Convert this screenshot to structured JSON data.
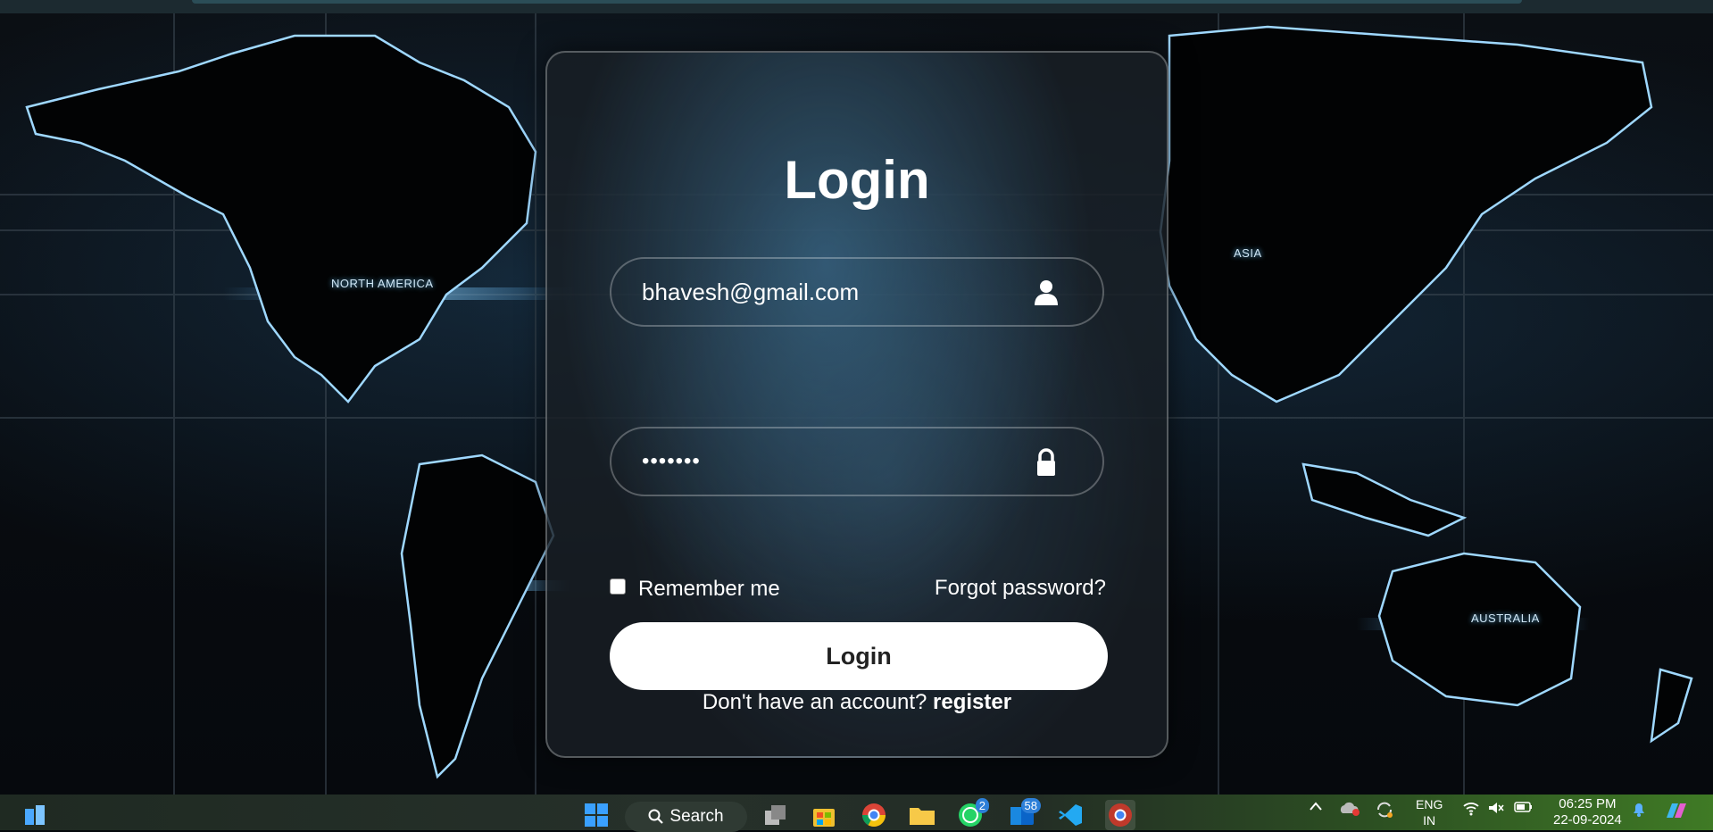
{
  "background": {
    "regions": [
      "NORTH AMERICA",
      "ASIA",
      "AUSTRALIA"
    ]
  },
  "login": {
    "title": "Login",
    "email_value": "bhavesh@gmail.com",
    "password_value": "•••••••",
    "email_icon": "user-icon",
    "password_icon": "lock-icon",
    "remember_label": "Remember me",
    "remember_checked": false,
    "forgot_label": "Forgot password?",
    "submit_label": "Login",
    "signup_prompt": "Don't have an account?",
    "signup_link": "register"
  },
  "taskbar": {
    "search_label": "Search",
    "whatsapp_badge": "2",
    "outlook_badge": "58",
    "language": "ENG",
    "region": "IN",
    "time": "06:25 PM",
    "date": "22-09-2024"
  }
}
